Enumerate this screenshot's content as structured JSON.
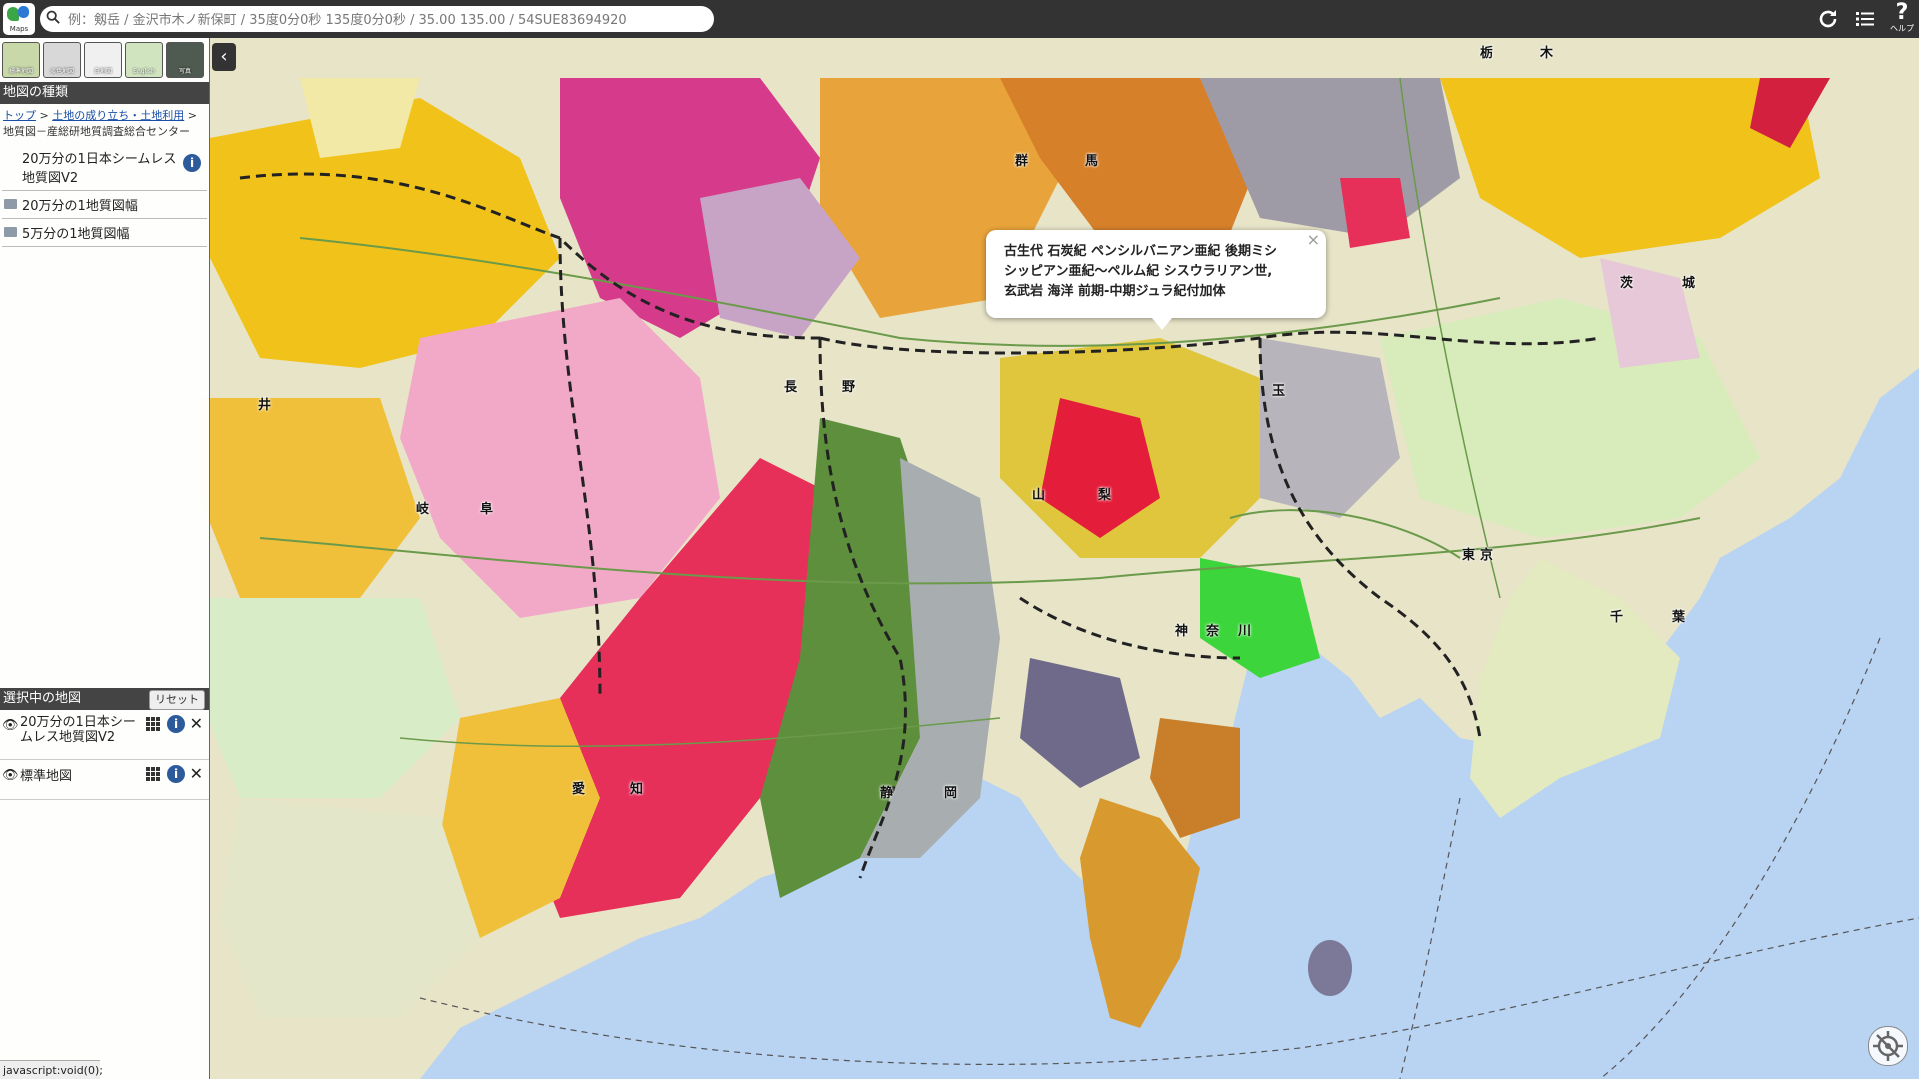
{
  "topbar": {
    "logo_label": "Maps",
    "search_placeholder": "例：剱岳 / 金沢市木ノ新保町 / 35度0分0秒 135度0分0秒 / 35.00 135.00 / 54SUE83694920",
    "icons": [
      "refresh-icon",
      "list-icon",
      "help-icon"
    ],
    "help_label": "ヘルプ"
  },
  "basemaps": [
    "標準地図",
    "淡色地図",
    "白地図",
    "English",
    "写真"
  ],
  "panel": {
    "map_types_title": "地図の種類",
    "breadcrumb": {
      "top": "トップ",
      "sep": " > ",
      "link": "土地の成り立ち・土地利用",
      "rest": " > 地質図－産総研地質調査総合センター"
    },
    "items": [
      {
        "label": "20万分の1日本シームレス地質図V2",
        "has_info": true
      },
      {
        "label": "20万分の1地質図幅"
      },
      {
        "label": "5万分の1地質図幅"
      }
    ],
    "selected_title": "選択中の地図",
    "reset_label": "リセット",
    "selected_items": [
      {
        "label": "20万分の1日本シームレス地質図V2"
      },
      {
        "label": "標準地図"
      }
    ]
  },
  "popup": {
    "text_line1": "古生代 石炭紀 ペンシルバニアン亜紀 後期ミシ",
    "text_line2": "シッピアン亜紀～ペルム紀 シスウラリアン世,",
    "text_line3": "玄武岩 海洋 前期-中期ジュラ紀付加体",
    "close": "×"
  },
  "status_text": "javascript:void(0);",
  "place_labels": [
    "栃",
    "木",
    "群",
    "馬",
    "茨",
    "城",
    "長",
    "野",
    "山",
    "梨",
    "東",
    "京",
    "千",
    "葉",
    "神",
    "奈",
    "川",
    "静",
    "岡",
    "愛",
    "知",
    "岐",
    "阜",
    "井",
    "玉"
  ],
  "colors": {
    "sea": "#b9d3f2",
    "topbar": "#333333",
    "info": "#2c5a9b"
  }
}
